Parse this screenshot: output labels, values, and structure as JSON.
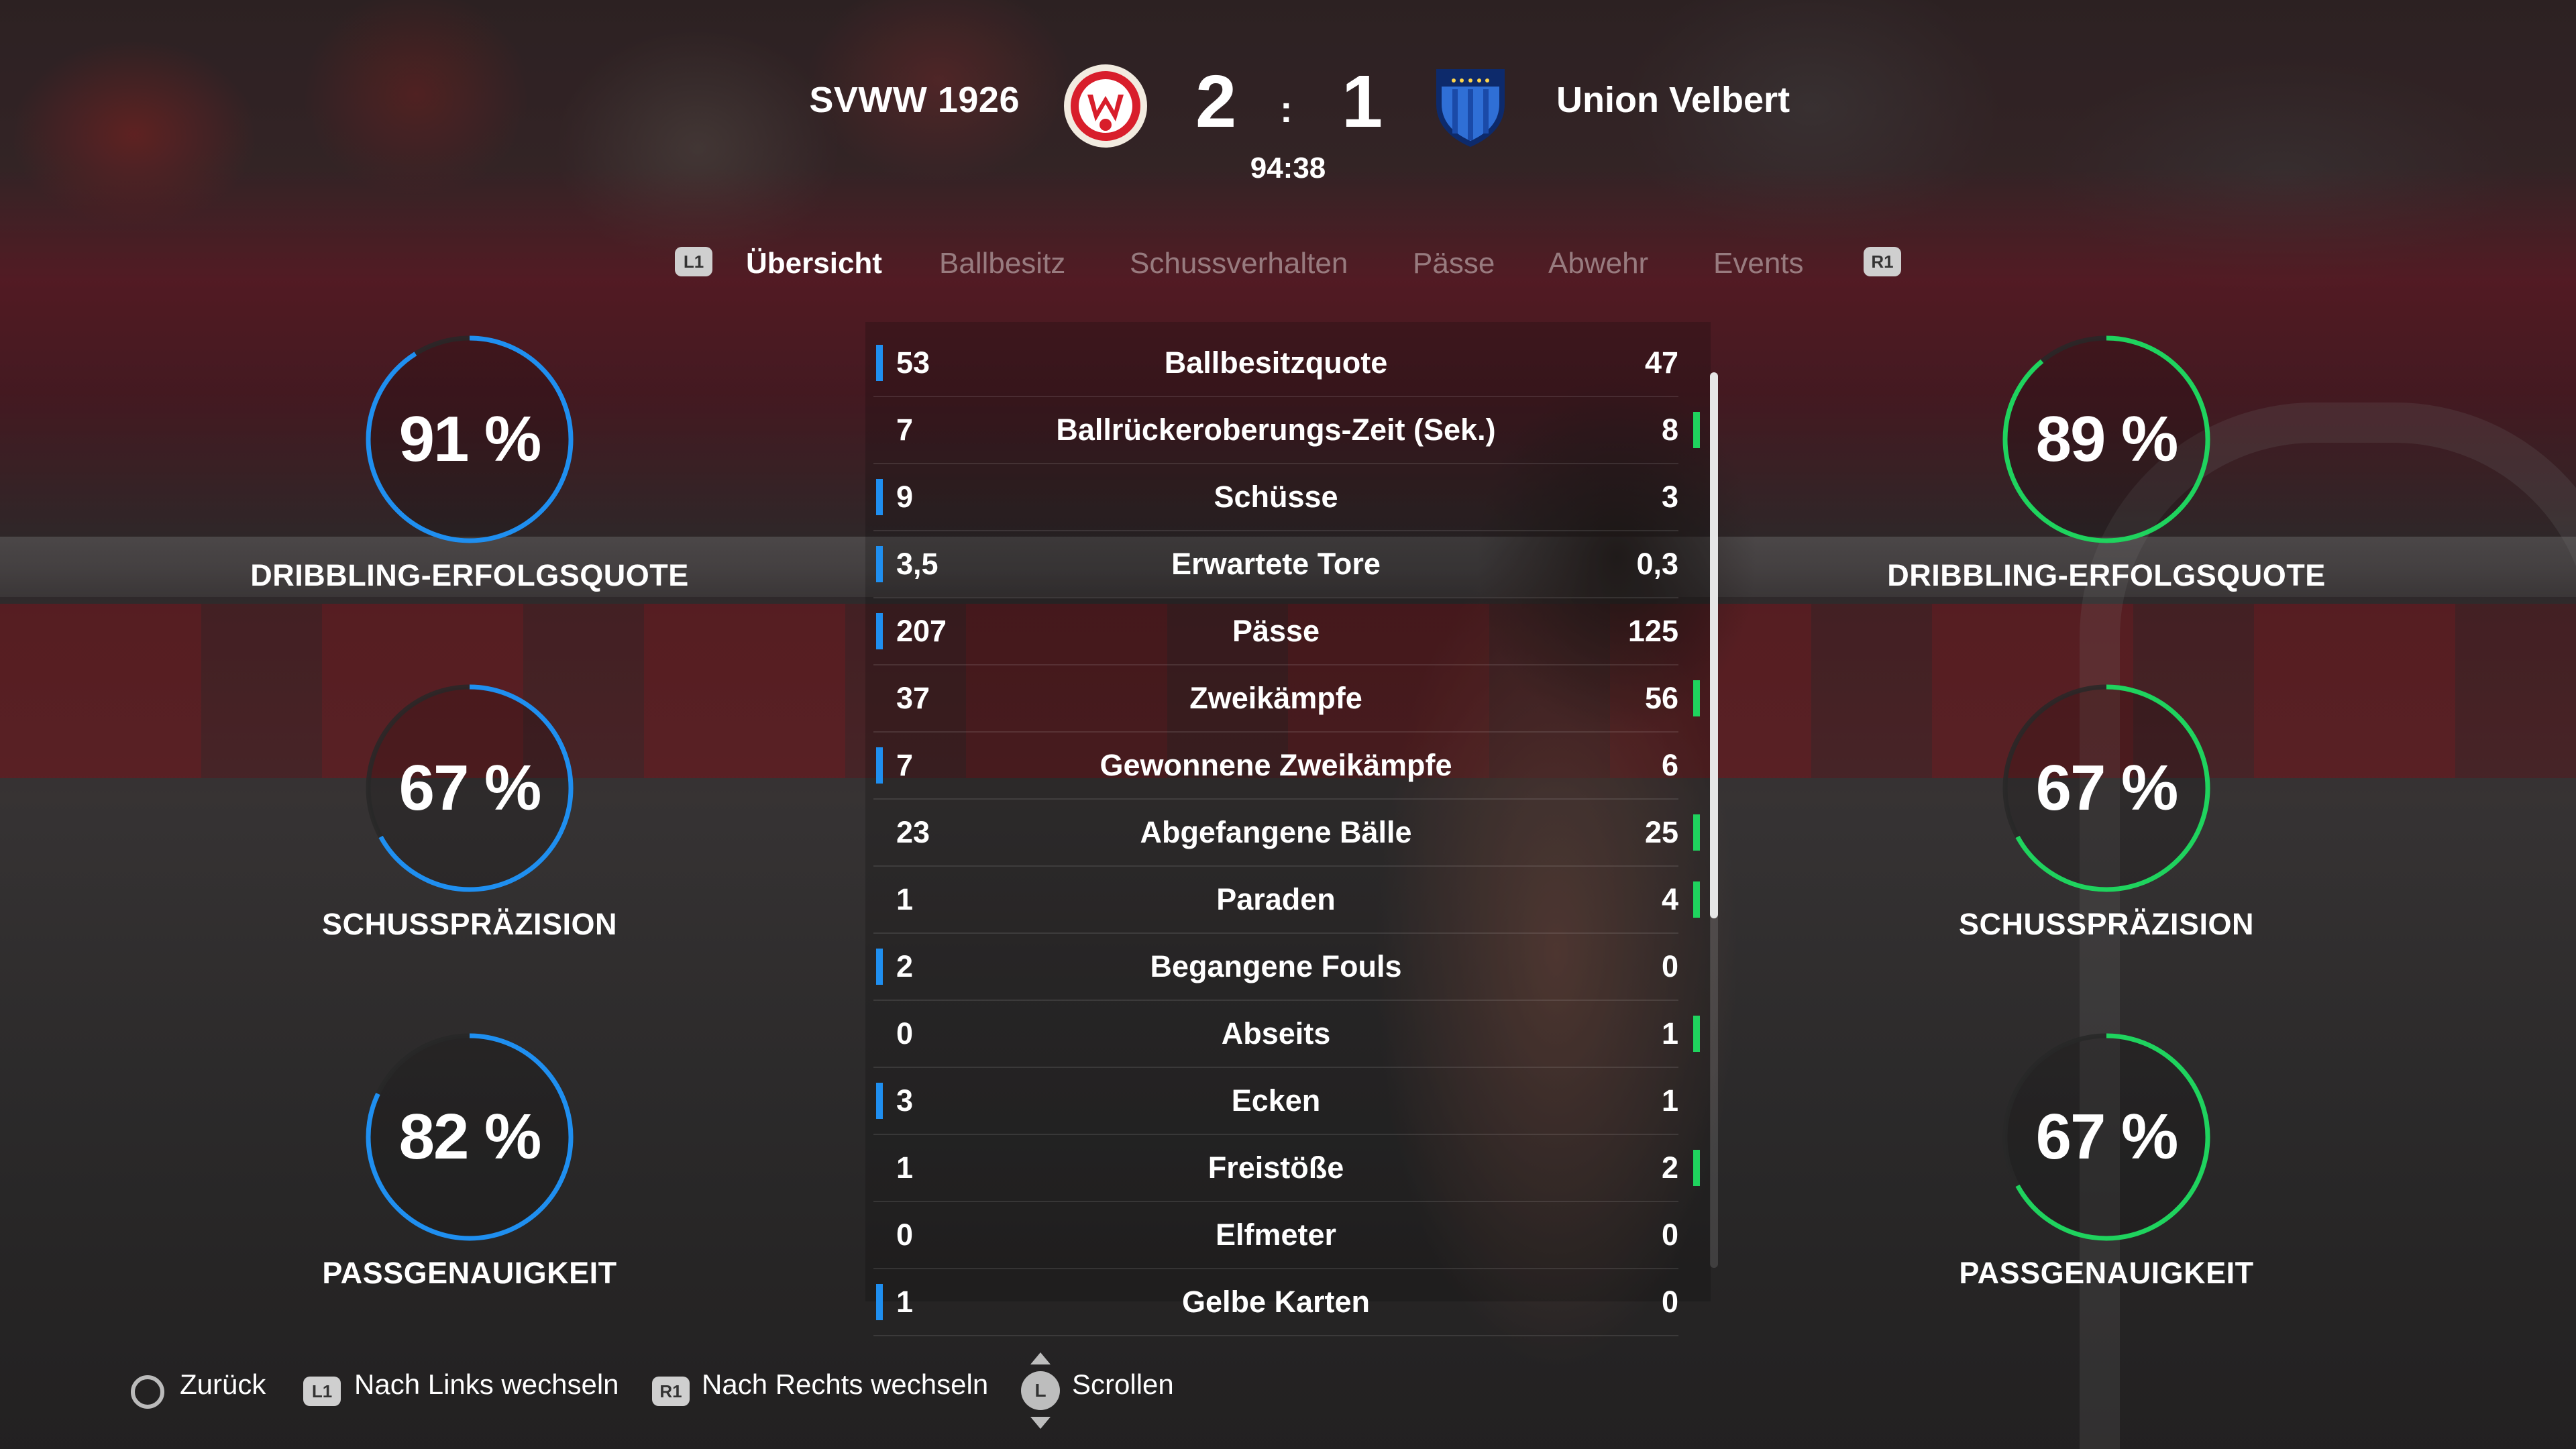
{
  "match": {
    "home_team": "SVWW 1926",
    "away_team": "Union Velbert",
    "home_score": "2",
    "separator": ":",
    "away_score": "1",
    "clock": "94:38",
    "home_color": "#1f8ff0",
    "away_color": "#1fd35e"
  },
  "tabs": {
    "left_button": "L1",
    "right_button": "R1",
    "items": [
      {
        "label": "Übersicht"
      },
      {
        "label": "Ballbesitz"
      },
      {
        "label": "Schussverhalten"
      },
      {
        "label": "Pässe"
      },
      {
        "label": "Abwehr"
      },
      {
        "label": "Events"
      }
    ],
    "active": "Übersicht"
  },
  "home_gauges": [
    {
      "value": "91 %",
      "percent": 91,
      "label": "DRIBBLING-ERFOLGSQUOTE"
    },
    {
      "value": "67 %",
      "percent": 67,
      "label": "SCHUSSPRÄZISION"
    },
    {
      "value": "82 %",
      "percent": 82,
      "label": "PASSGENAUIGKEIT"
    }
  ],
  "away_gauges": [
    {
      "value": "89 %",
      "percent": 89,
      "label": "DRIBBLING-ERFOLGSQUOTE"
    },
    {
      "value": "67 %",
      "percent": 67,
      "label": "SCHUSSPRÄZISION"
    },
    {
      "value": "67 %",
      "percent": 67,
      "label": "PASSGENAUIGKEIT"
    }
  ],
  "stats": [
    {
      "home": "53",
      "label": "Ballbesitzquote",
      "away": "47",
      "leader": "home"
    },
    {
      "home": "7",
      "label": "Ballrückeroberungs-Zeit (Sek.)",
      "away": "8",
      "leader": "away"
    },
    {
      "home": "9",
      "label": "Schüsse",
      "away": "3",
      "leader": "home"
    },
    {
      "home": "3,5",
      "label": "Erwartete Tore",
      "away": "0,3",
      "leader": "home"
    },
    {
      "home": "207",
      "label": "Pässe",
      "away": "125",
      "leader": "home"
    },
    {
      "home": "37",
      "label": "Zweikämpfe",
      "away": "56",
      "leader": "away"
    },
    {
      "home": "7",
      "label": "Gewonnene Zweikämpfe",
      "away": "6",
      "leader": "home"
    },
    {
      "home": "23",
      "label": "Abgefangene Bälle",
      "away": "25",
      "leader": "away"
    },
    {
      "home": "1",
      "label": "Paraden",
      "away": "4",
      "leader": "away"
    },
    {
      "home": "2",
      "label": "Begangene Fouls",
      "away": "0",
      "leader": "home"
    },
    {
      "home": "0",
      "label": "Abseits",
      "away": "1",
      "leader": "away"
    },
    {
      "home": "3",
      "label": "Ecken",
      "away": "1",
      "leader": "home"
    },
    {
      "home": "1",
      "label": "Freistöße",
      "away": "2",
      "leader": "away"
    },
    {
      "home": "0",
      "label": "Elfmeter",
      "away": "0",
      "leader": "none"
    },
    {
      "home": "1",
      "label": "Gelbe Karten",
      "away": "0",
      "leader": "home"
    }
  ],
  "scroll": {
    "visible_fraction": 0.61
  },
  "hints": {
    "back": "Zurück",
    "back_button": "circle-button-icon",
    "left": "Nach Links wechseln",
    "left_button": "L1",
    "right": "Nach Rechts wechseln",
    "right_button": "R1",
    "scroll": "Scrollen",
    "scroll_button": "L"
  }
}
